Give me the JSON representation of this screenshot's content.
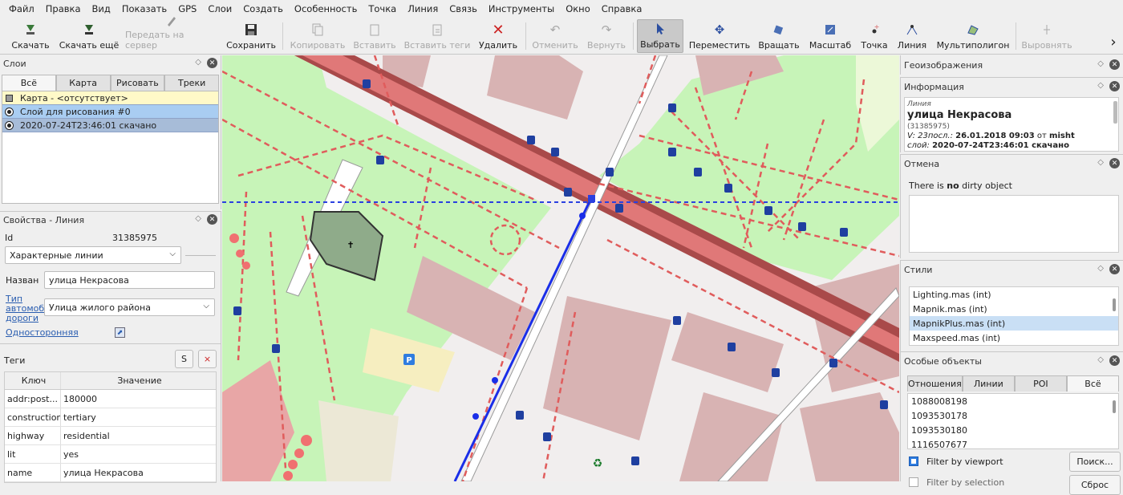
{
  "menu": [
    "Файл",
    "Правка",
    "Вид",
    "Показать",
    "GPS",
    "Слои",
    "Создать",
    "Особенность",
    "Точка",
    "Линия",
    "Связь",
    "Инструменты",
    "Окно",
    "Справка"
  ],
  "toolbar": {
    "download": "Скачать",
    "download_more": "Скачать ещё",
    "upload": "Передать на сервер",
    "save": "Сохранить",
    "copy": "Копировать",
    "paste": "Вставить",
    "paste_tags": "Вставить теги",
    "delete": "Удалить",
    "undo": "Отменить",
    "redo": "Вернуть",
    "select": "Выбрать",
    "move": "Переместить",
    "rotate": "Вращать",
    "scale": "Масштаб",
    "point": "Точка",
    "line": "Линия",
    "multipolygon": "Мультиполигон",
    "align": "Выровнять",
    "more": "›"
  },
  "layers": {
    "title": "Слои",
    "tabs": [
      "Всё",
      "Карта",
      "Рисовать",
      "Треки"
    ],
    "items": [
      "Карта - <отсутствует>",
      "Слой для рисования #0",
      "2020-07-24T23:46:01 скачано"
    ]
  },
  "properties": {
    "title": "Свойства - Линия",
    "id_label": "Id",
    "id_value": "31385975",
    "preset": "Характерные линии",
    "name_label": "Назван",
    "name_value": "улица Некрасова",
    "road_type_label_1": "Тип",
    "road_type_label_2": "автомоб",
    "road_type_label_3": "дороги",
    "road_type_value": "Улица жилого района",
    "oneway": "Односторонняя",
    "tags_label": "Теги",
    "tags_btn_s": "S",
    "tags_btn_x": "×",
    "col_key": "Ключ",
    "col_value": "Значение",
    "tags": [
      {
        "k": "addr:post...",
        "v": "180000"
      },
      {
        "k": "construction",
        "v": "tertiary"
      },
      {
        "k": "highway",
        "v": "residential"
      },
      {
        "k": "lit",
        "v": "yes"
      },
      {
        "k": "name",
        "v": "улица Некрасова"
      }
    ]
  },
  "right": {
    "geoimages": "Геоизображения",
    "info_title": "Информация",
    "info_type": "Линия",
    "info_name": "улица Некрасова",
    "info_id": "(31385975)",
    "info_version_label": "V: 23посл.:",
    "info_version_value": "26.01.2018 09:03",
    "info_from": "от",
    "info_user": "misht",
    "info_layer_label": "слой:",
    "info_layer_value": "2020-07-24T23:46:01 скачано",
    "undo_title": "Отмена",
    "undo_text_1": "There is ",
    "undo_text_bold": "no",
    "undo_text_2": " dirty object",
    "styles_title": "Стили",
    "styles": [
      "Lighting.mas (int)",
      "Mapnik.mas (int)",
      "MapnikPlus.mas (int)",
      "Maxspeed.mas (int)"
    ],
    "special_title": "Особые объекты",
    "special_tabs": [
      "Отношения",
      "Линии",
      "POI",
      "Всё"
    ],
    "special_items": [
      "1088008198",
      "1093530178",
      "1093530180",
      "1116507677"
    ],
    "filter_viewport": "Filter by viewport",
    "filter_selection": "Filter by selection",
    "search_btn": "Поиск...",
    "clear_btn": "Сброс"
  }
}
